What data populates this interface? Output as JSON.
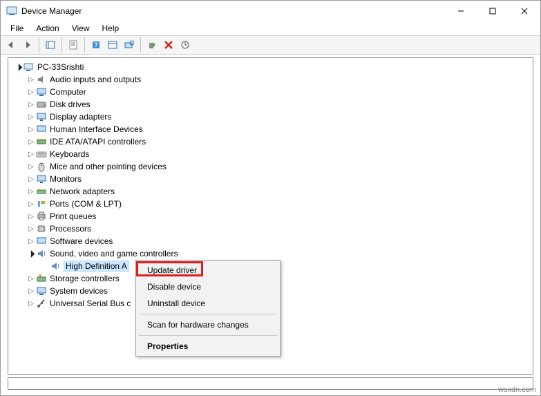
{
  "window": {
    "title": "Device Manager"
  },
  "menubar": {
    "file": "File",
    "action": "Action",
    "view": "View",
    "help": "Help"
  },
  "tree": {
    "root": "PC-33Srishti",
    "categories": [
      "Audio inputs and outputs",
      "Computer",
      "Disk drives",
      "Display adapters",
      "Human Interface Devices",
      "IDE ATA/ATAPI controllers",
      "Keyboards",
      "Mice and other pointing devices",
      "Monitors",
      "Network adapters",
      "Ports (COM & LPT)",
      "Print queues",
      "Processors",
      "Software devices"
    ],
    "sound_label": "Sound, video and game controllers",
    "sound_child": "High Definition A",
    "rest": [
      "Storage controllers",
      "System devices",
      "Universal Serial Bus c"
    ]
  },
  "context_menu": {
    "update": "Update driver",
    "disable": "Disable device",
    "uninstall": "Uninstall device",
    "scan": "Scan for hardware changes",
    "props": "Properties"
  },
  "watermark": "wsxdn.com"
}
